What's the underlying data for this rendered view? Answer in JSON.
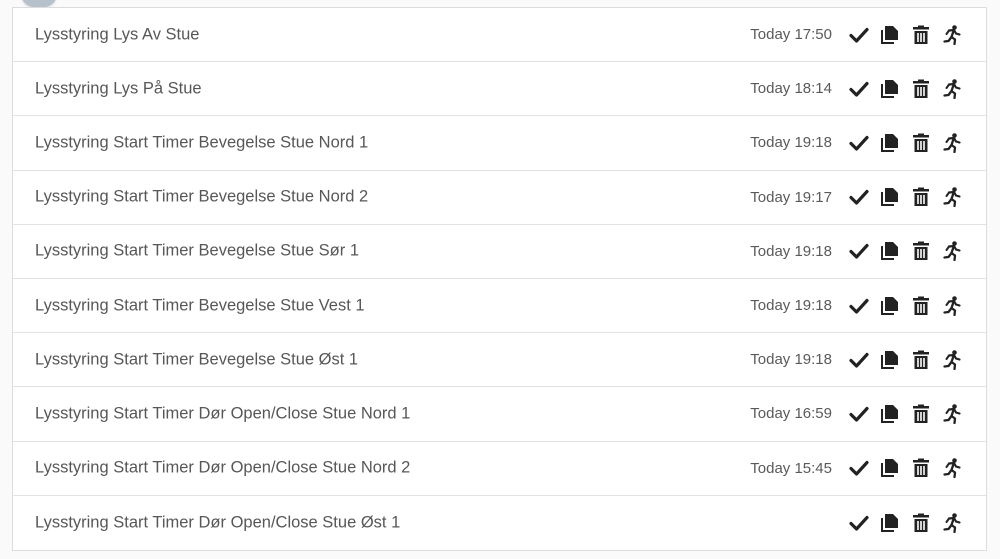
{
  "automations": {
    "rows": [
      {
        "name": "Lysstyring Lys Av Stue",
        "last_triggered": "Today 17:50"
      },
      {
        "name": "Lysstyring Lys På Stue",
        "last_triggered": "Today 18:14"
      },
      {
        "name": "Lysstyring Start Timer Bevegelse Stue Nord 1",
        "last_triggered": "Today 19:18"
      },
      {
        "name": "Lysstyring Start Timer Bevegelse Stue Nord 2",
        "last_triggered": "Today 19:17"
      },
      {
        "name": "Lysstyring Start Timer Bevegelse Stue Sør 1",
        "last_triggered": "Today 19:18"
      },
      {
        "name": "Lysstyring Start Timer Bevegelse Stue Vest 1",
        "last_triggered": "Today 19:18"
      },
      {
        "name": "Lysstyring Start Timer Bevegelse Stue Øst 1",
        "last_triggered": "Today 19:18"
      },
      {
        "name": "Lysstyring Start Timer Dør Open/Close Stue Nord 1",
        "last_triggered": "Today 16:59"
      },
      {
        "name": "Lysstyring Start Timer Dør Open/Close Stue Nord 2",
        "last_triggered": "Today 15:45"
      },
      {
        "name": "Lysstyring Start Timer Dør Open/Close Stue Øst 1",
        "last_triggered": ""
      }
    ],
    "actions": [
      "check-icon",
      "copy-icon",
      "trash-icon",
      "run-icon"
    ]
  },
  "colors": {
    "icon": "#222222",
    "text": "#575757",
    "border": "#e2e2e2"
  }
}
